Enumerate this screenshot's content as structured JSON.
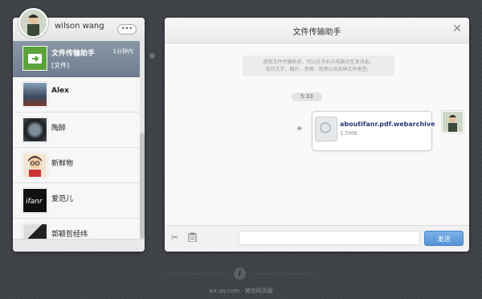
{
  "user": {
    "name": "wilson wang",
    "more_label": "•••"
  },
  "contacts": [
    {
      "name": "文件传输助手",
      "last_message": "[文件]",
      "time": "1分钟内",
      "active": true,
      "avatar": "file-transfer-icon"
    },
    {
      "name": "Alex",
      "avatar": "alex-avatar"
    },
    {
      "name": "陶醉",
      "avatar": "taozui-avatar"
    },
    {
      "name": "新鲜物",
      "avatar": "xinxianwu-avatar"
    },
    {
      "name": "爱范儿",
      "avatar": "ifanr-avatar"
    },
    {
      "name": "郭颖哲经纬",
      "avatar": "guoyingzhe-avatar"
    }
  ],
  "chat": {
    "title": "文件传输助手",
    "close_label": "✕",
    "notice_line1": "使用文件传输助手，可以在手机与电脑间互发消息。",
    "notice_line2": "支持文字、图片、音频、视频以及各种文件类型。",
    "time": "5:33",
    "file": {
      "name": "aboutifanr.pdf.webarchive",
      "size": "1.5MB"
    },
    "input_value": "",
    "send_label": "发送"
  },
  "footer": {
    "text": "wx.qq.com · 微信网页版"
  },
  "colors": {
    "accent": "#5593d6",
    "active_row": "#7a8899",
    "background": "#3e4147"
  }
}
